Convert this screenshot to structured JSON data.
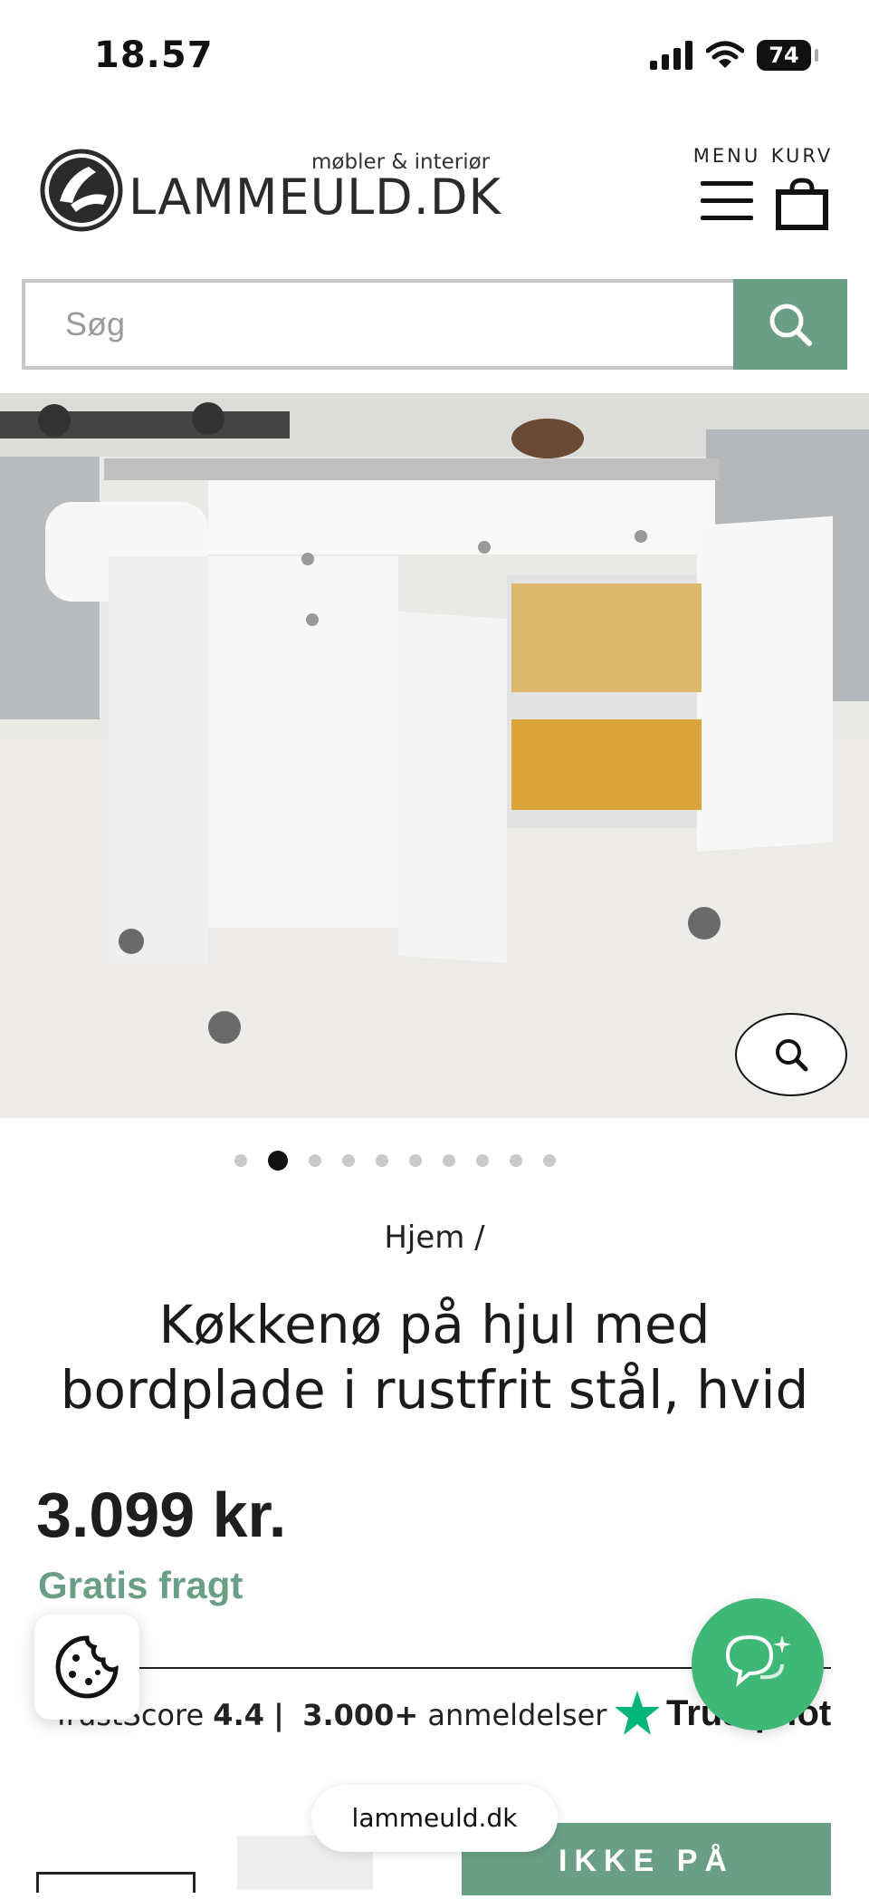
{
  "status_bar": {
    "time": "18.57",
    "battery": "74"
  },
  "header": {
    "logo_text": "LAMMEULD.DK",
    "logo_tagline": "møbler & interiør",
    "menu_label": "MENU",
    "cart_label": "KURV"
  },
  "search": {
    "placeholder": "Søg"
  },
  "breadcrumb": "Hjem /",
  "product": {
    "title": "Køkkenø på hjul med bordplade i rustfrit stål, hvid",
    "price": "3.099 kr.",
    "shipping": "Gratis fragt"
  },
  "gallery": {
    "total_slides": 10,
    "active_index": 1
  },
  "trust": {
    "label": "TrustScore",
    "score": "4.4",
    "separator": "|",
    "reviews_count": "3.000+",
    "reviews_label": "anmeldelser",
    "brand": "Trustpilot"
  },
  "buttons": {
    "stock": "IKKE PÅ"
  },
  "browser": {
    "url": "lammeuld.dk"
  },
  "colors": {
    "accent": "#6a9e86",
    "chat": "#3fb877",
    "trustpilot_star": "#00b67a"
  }
}
